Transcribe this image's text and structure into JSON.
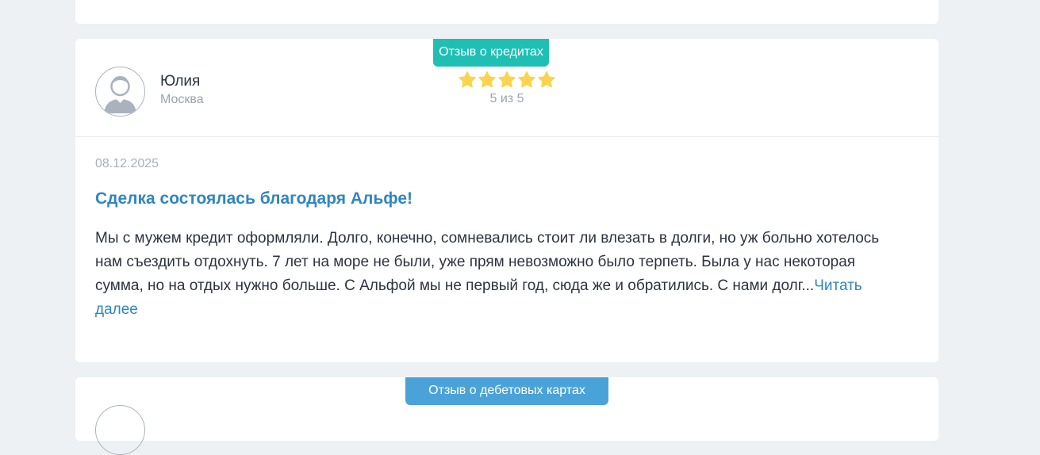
{
  "review": {
    "category": "Отзыв о кредитах",
    "author_name": "Юлия",
    "author_city": "Москва",
    "rating_value": 5,
    "rating_max": 5,
    "rating_text": "5 из 5",
    "date": "08.12.2025",
    "title": "Сделка состоялась благодаря Альфе!",
    "text": "Мы с мужем кредит оформляли. Долго, конечно, сомневались стоит ли влезать в долги, но уж больно хотелось нам съездить отдохнуть. 7 лет на море не были, уже прям невозможно было терпеть. Была у нас некоторая сумма, но на отдых нужно больше. С Альфой мы не первый год, сюда же и обратились. С нами долг...",
    "read_more": "Читать далее"
  },
  "next_review": {
    "category": "Отзыв о дебетовых картах"
  },
  "icons": {
    "avatar": "user-avatar-icon",
    "star": "star-icon"
  },
  "colors": {
    "credit_badge": "#1fbfb4",
    "debit_badge": "#4aa3d8",
    "star": "#fcd34d",
    "link": "#2f86c1"
  }
}
